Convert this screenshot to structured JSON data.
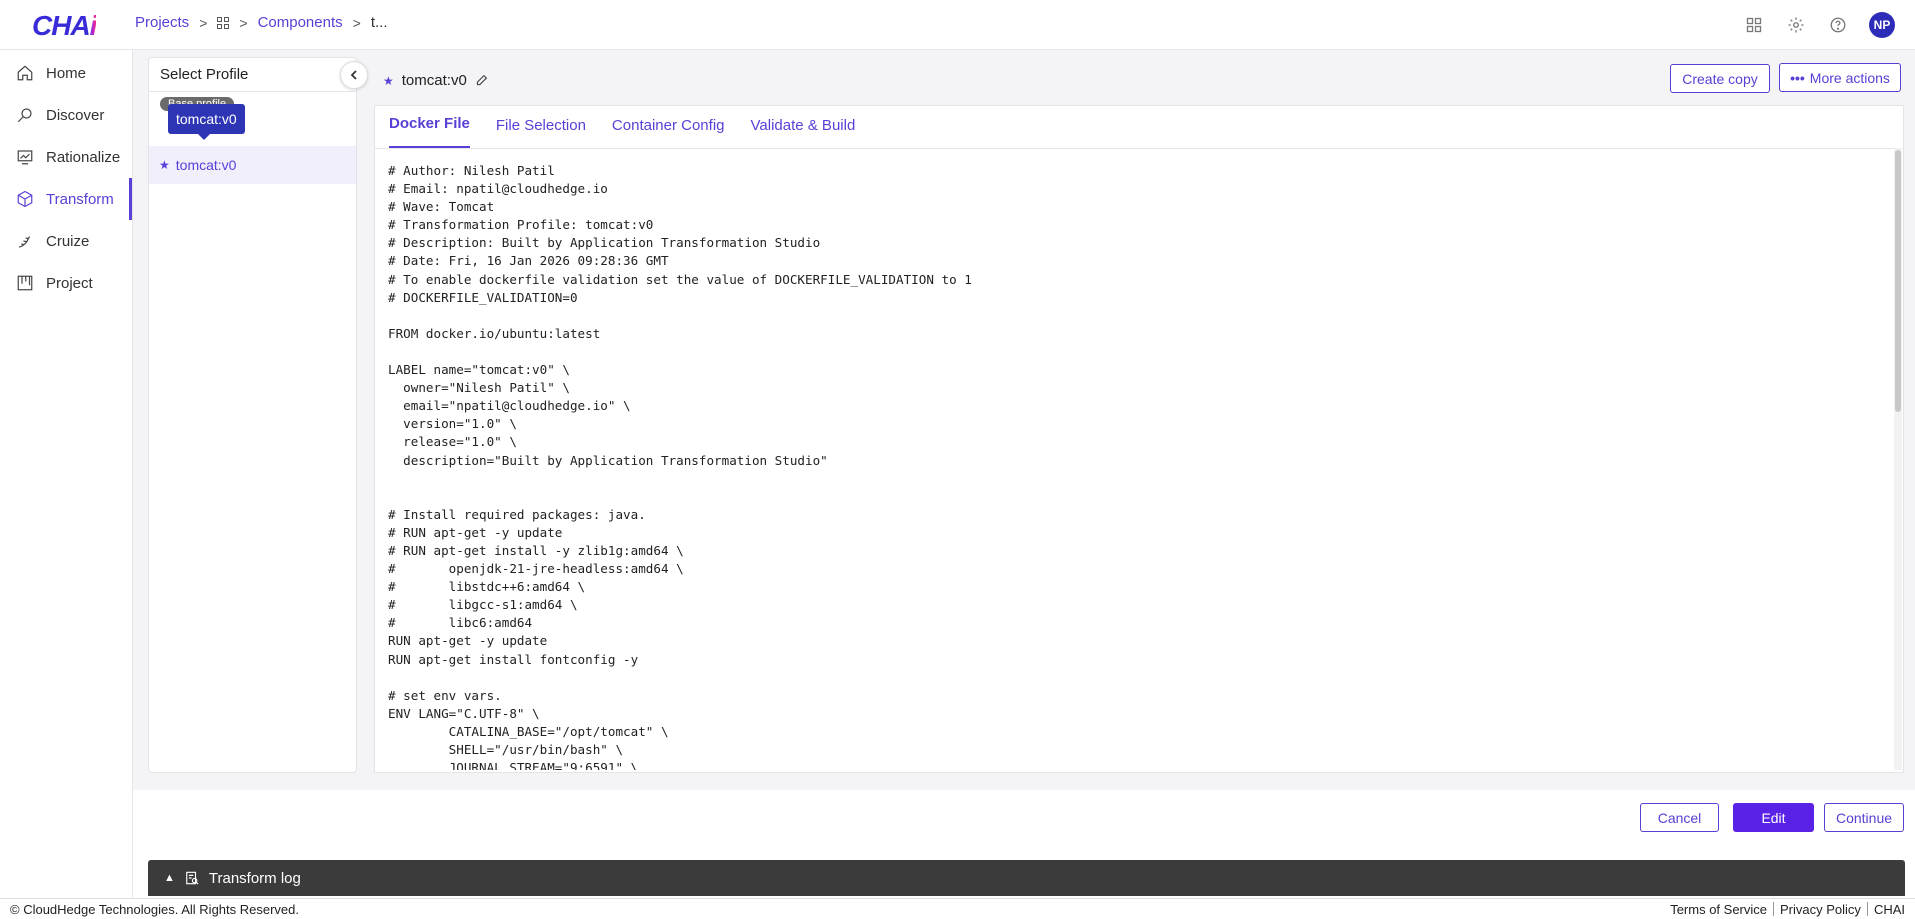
{
  "app": {
    "logo_text": "CHA",
    "logo_accent": "i"
  },
  "breadcrumb": {
    "projects": "Projects",
    "components": "Components",
    "current": "t..."
  },
  "header": {
    "avatar_initials": "NP"
  },
  "nav": {
    "items": [
      {
        "label": "Home",
        "icon": "home-icon"
      },
      {
        "label": "Discover",
        "icon": "discover-icon"
      },
      {
        "label": "Rationalize",
        "icon": "rationalize-icon"
      },
      {
        "label": "Transform",
        "icon": "transform-icon"
      },
      {
        "label": "Cruize",
        "icon": "cruize-icon"
      },
      {
        "label": "Project",
        "icon": "project-icon"
      }
    ],
    "active": "Transform"
  },
  "profile_panel": {
    "title": "Select Profile",
    "base_chip": "Base profile",
    "tooltip": "tomcat:v0",
    "selected": "tomcat:v0"
  },
  "editor": {
    "profile_name": "tomcat:v0",
    "create_copy": "Create copy",
    "more_actions": "More actions",
    "tabs": [
      "Docker File",
      "File Selection",
      "Container Config",
      "Validate & Build"
    ],
    "active_tab": "Docker File",
    "code": "# Author: Nilesh Patil\n# Email: npatil@cloudhedge.io\n# Wave: Tomcat\n# Transformation Profile: tomcat:v0\n# Description: Built by Application Transformation Studio\n# Date: Fri, 16 Jan 2026 09:28:36 GMT\n# To enable dockerfile validation set the value of DOCKERFILE_VALIDATION to 1\n# DOCKERFILE_VALIDATION=0\n\nFROM docker.io/ubuntu:latest\n\nLABEL name=\"tomcat:v0\" \\\n  owner=\"Nilesh Patil\" \\\n  email=\"npatil@cloudhedge.io\" \\\n  version=\"1.0\" \\\n  release=\"1.0\" \\\n  description=\"Built by Application Transformation Studio\"\n\n\n# Install required packages: java.\n# RUN apt-get -y update\n# RUN apt-get install -y zlib1g:amd64 \\\n#       openjdk-21-jre-headless:amd64 \\\n#       libstdc++6:amd64 \\\n#       libgcc-s1:amd64 \\\n#       libc6:amd64\nRUN apt-get -y update\nRUN apt-get install fontconfig -y\n\n# set env vars.\nENV LANG=\"C.UTF-8\" \\\n        CATALINA_BASE=\"/opt/tomcat\" \\\n        SHELL=\"/usr/bin/bash\" \\\n        JOURNAL_STREAM=\"9:6591\" \\"
  },
  "actions": {
    "cancel": "Cancel",
    "edit": "Edit",
    "continue": "Continue"
  },
  "log": {
    "label": "Transform log"
  },
  "footer": {
    "copyright": "© CloudHedge Technologies. All Rights Reserved.",
    "terms": "Terms of Service",
    "privacy": "Privacy Policy",
    "brand": "CHAI"
  },
  "colors": {
    "accent": "#5a3fd6",
    "button": "#5a21e6",
    "logbar": "#3b3b3b"
  }
}
